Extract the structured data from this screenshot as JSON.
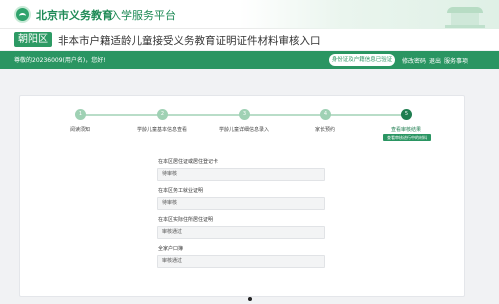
{
  "header": {
    "site_title": "北京市义务教育",
    "site_subtitle": "入学服务平台"
  },
  "banner": {
    "district": "朝阳区",
    "title": "非本市户籍适龄儿童接受义务教育证明证件材料审核入口"
  },
  "navbar": {
    "greeting": "尊敬的20236009(用户名)，您好!",
    "verify_button": "身份证及户籍信息已验证",
    "links": [
      "修改密码",
      "退出",
      "服务事项"
    ]
  },
  "steps": [
    {
      "number": "1",
      "label": "阅读须知"
    },
    {
      "number": "2",
      "label": "学龄儿童基本信息查看"
    },
    {
      "number": "3",
      "label": "学龄儿童详细信息录入"
    },
    {
      "number": "4",
      "label": "家长预约"
    },
    {
      "number": "5",
      "label": "查看审核结果",
      "badge": "查看审核进行中的材料"
    }
  ],
  "fields": [
    {
      "label": "在本区居住证或居住登记卡",
      "value": "待审核"
    },
    {
      "label": "在本区务工就业证明",
      "value": "待审核"
    },
    {
      "label": "在本区实际住所居住证明",
      "value": "审核通过"
    },
    {
      "label": "全家户口簿",
      "value": "审核通过"
    }
  ],
  "colors": {
    "brand_green": "#2a9562",
    "active_step": "#1f7d50",
    "inactive_step": "#9fd1b4"
  }
}
